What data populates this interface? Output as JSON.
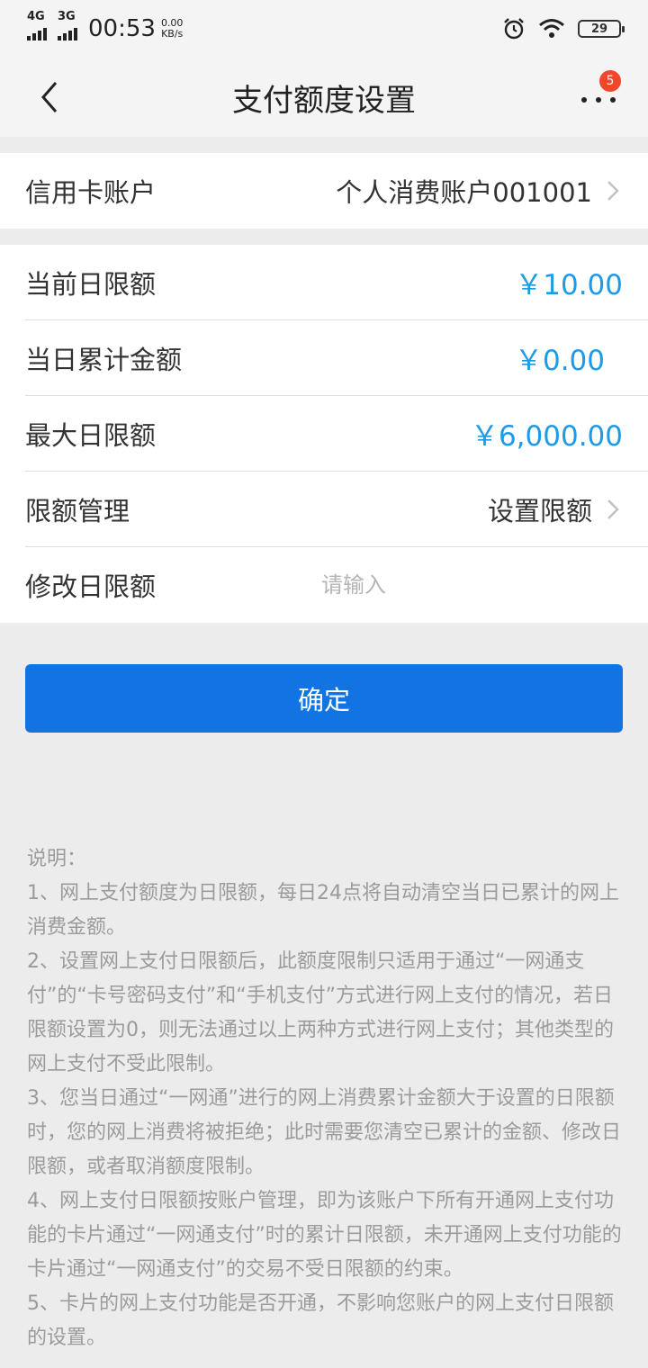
{
  "status_bar": {
    "net1": "4G",
    "net2": "3G",
    "time": "00:53",
    "speed_value": "0.00",
    "speed_unit": "KB/s",
    "battery": "29"
  },
  "header": {
    "title": "支付额度设置",
    "badge": "5"
  },
  "account": {
    "label": "信用卡账户",
    "value": "个人消费账户001001"
  },
  "limits": {
    "current_label": "当前日限额",
    "current_value": "￥10.00",
    "accum_label": "当日累计金额",
    "accum_value": "￥0.00",
    "max_label": "最大日限额",
    "max_value": "￥6,000.00",
    "manage_label": "限额管理",
    "manage_value": "设置限额",
    "modify_label": "修改日限额",
    "modify_placeholder": "请输入"
  },
  "confirm_label": "确定",
  "notes": [
    "说明：",
    "1、网上支付额度为日限额，每日24点将自动清空当日已累计的网上消费金额。",
    "2、设置网上支付日限额后，此额度限制只适用于通过“一网通支付”的“卡号密码支付”和“手机支付”方式进行网上支付的情况，若日限额设置为0，则无法通过以上两种方式进行网上支付；其他类型的网上支付不受此限制。",
    "3、您当日通过“一网通”进行的网上消费累计金额大于设置的日限额时，您的网上消费将被拒绝；此时需要您清空已累计的金额、修改日限额，或者取消额度限制。",
    "4、网上支付日限额按账户管理，即为该账户下所有开通网上支付功能的卡片通过“一网通支付”时的累计日限额，未开通网上支付功能的卡片通过“一网通支付”的交易不受日限额的约束。",
    "5、卡片的网上支付功能是否开通，不影响您账户的网上支付日限额的设置。"
  ]
}
